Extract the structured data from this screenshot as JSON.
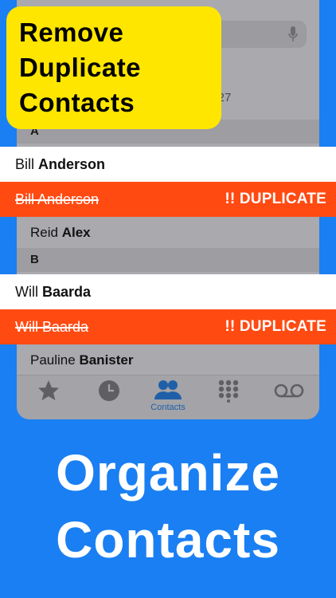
{
  "callout": {
    "line1": "Remove",
    "line2": "Duplicate",
    "line3": "Contacts"
  },
  "phone": {
    "card_number": "2827",
    "sections": [
      {
        "letter": "A"
      },
      {
        "letter": "B"
      }
    ],
    "rows": [
      {
        "first": "Reid",
        "last": "Alex"
      },
      {
        "first": "Pauline",
        "last": "Banister"
      }
    ],
    "tabbar": {
      "favorites_icon": "star-icon",
      "recents_icon": "clock-icon",
      "contacts_icon": "contacts-icon",
      "contacts_label": "Contacts",
      "keypad_icon": "keypad-icon",
      "voicemail_icon": "voicemail-icon",
      "active_color": "#1f5fa8"
    }
  },
  "strips": [
    {
      "first": "Bill",
      "last": "Anderson"
    },
    {
      "name": "Bill Anderson",
      "label": "!! DUPLICATE"
    },
    {
      "first": "Will",
      "last": "Baarda"
    },
    {
      "name": "Will Baarda",
      "label": "!! DUPLICATE"
    }
  ],
  "headline": {
    "line1": "Organize",
    "line2": "Contacts"
  },
  "colors": {
    "background": "#1a7ff2",
    "duplicate": "#ff4a12",
    "callout": "#ffe600"
  }
}
